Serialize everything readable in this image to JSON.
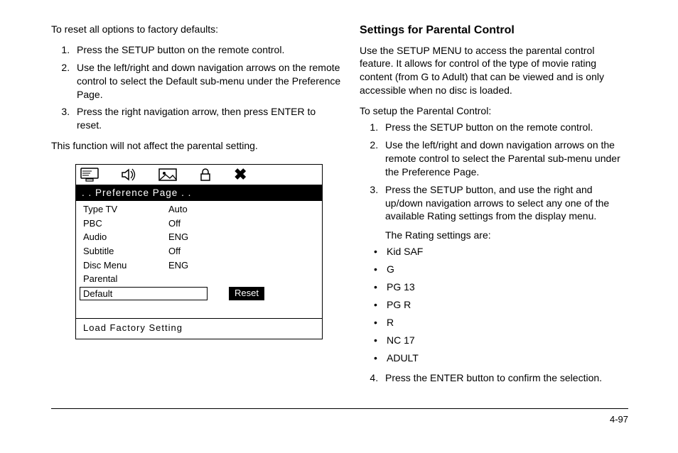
{
  "left": {
    "intro": "To reset all options to factory defaults:",
    "steps": [
      "Press the SETUP button on the remote control.",
      "Use the left/right and down navigation arrows on the remote control to select the Default sub-menu under the Preference Page.",
      "Press the right navigation arrow, then press ENTER to reset."
    ],
    "note": "This function will not affect the parental setting.",
    "osd": {
      "title": ". . Preference  Page . .",
      "rows": [
        {
          "k": "Type TV",
          "v": "Auto"
        },
        {
          "k": "PBC",
          "v": "Off"
        },
        {
          "k": "Audio",
          "v": "ENG"
        },
        {
          "k": "Subtitle",
          "v": "Off"
        },
        {
          "k": "Disc  Menu",
          "v": "ENG"
        },
        {
          "k": "Parental",
          "v": ""
        }
      ],
      "selected": {
        "k": "Default",
        "v": "Reset"
      },
      "footer": "Load  Factory  Setting"
    }
  },
  "right": {
    "heading": "Settings for Parental Control",
    "intro": "Use the SETUP MENU to access the parental control feature. It allows for control of the type of movie rating content (from G to Adult) that can be viewed and is only accessible when no disc is loaded.",
    "lead": "To setup the Parental Control:",
    "steps": [
      "Press the SETUP button on the remote control.",
      "Use the left/right and down navigation arrows on the remote control to select the Parental sub-menu under the Preference Page.",
      "Press the SETUP button, and use the right and up/down navigation arrows to select any one of the available Rating settings from the display menu."
    ],
    "ratings_lead": "The Rating settings are:",
    "ratings": [
      "Kid SAF",
      "G",
      "PG 13",
      "PG R",
      "R",
      "NC 17",
      "ADULT"
    ],
    "step4": "Press the ENTER button to confirm the selection."
  },
  "page_number": "4-97"
}
